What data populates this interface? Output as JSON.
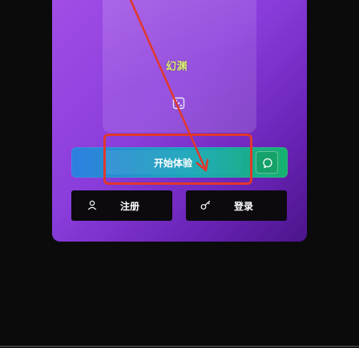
{
  "hero": {
    "title": "幻渊"
  },
  "actions": {
    "start_label": "开始体验",
    "register_label": "注册",
    "login_label": "登录"
  },
  "icons": {
    "dice": "dice-icon",
    "chat": "chat-icon",
    "user": "user-icon",
    "key": "key-icon"
  },
  "colors": {
    "card_gradient_start": "#a24ee6",
    "card_gradient_end": "#4b148b",
    "title_color": "#d8f06a",
    "start_gradient_start": "#2e7fe0",
    "start_gradient_end": "#17b26f",
    "highlight": "#e0382c"
  }
}
